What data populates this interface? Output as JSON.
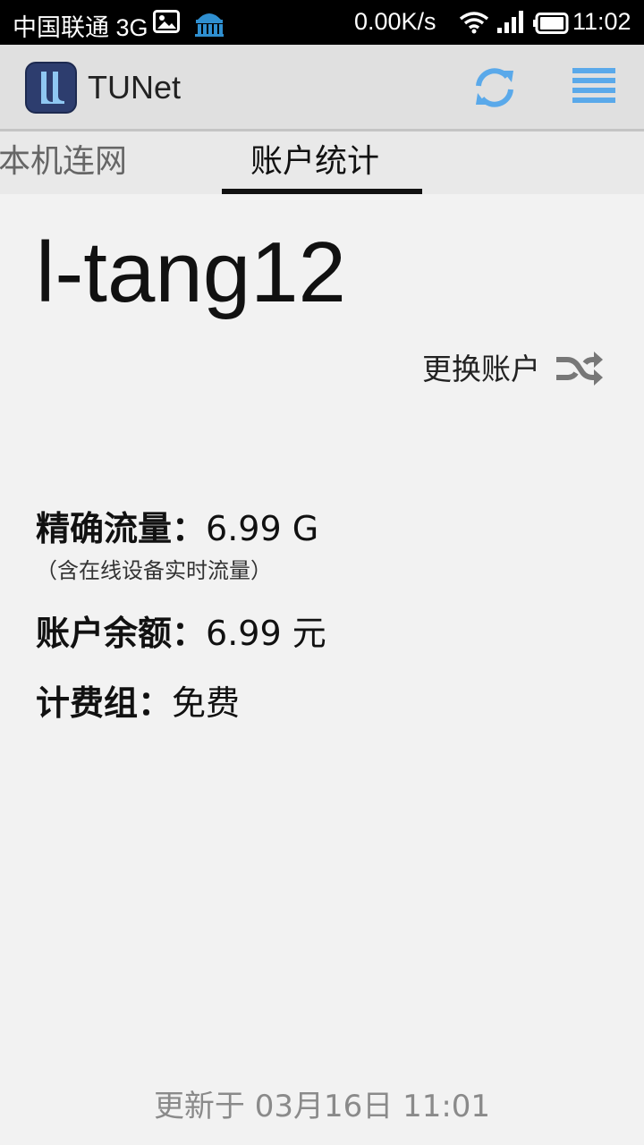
{
  "status_bar": {
    "carrier": "中国联通 3G",
    "net_speed": "0.00K/s",
    "time": "11:02",
    "icons": [
      "photo-icon",
      "university-app-icon",
      "wifi-icon",
      "signal-icon",
      "battery-icon"
    ]
  },
  "app_bar": {
    "title": "TUNet",
    "actions": [
      "refresh-icon",
      "menu-icon"
    ],
    "accent_color": "#5aa9ea"
  },
  "tabs": [
    {
      "label": "本机连网",
      "selected": false
    },
    {
      "label": "账户统计",
      "selected": true
    }
  ],
  "account": {
    "username": "l-tang12",
    "switch_label": "更换账户"
  },
  "stats": {
    "colon": "：",
    "traffic_label": "精确流量",
    "traffic_value": "6.99 G",
    "traffic_note": "（含在线设备实时流量）",
    "balance_label": "账户余额",
    "balance_value": "6.99 元",
    "group_label": "计费组",
    "group_value": "免费"
  },
  "footer": {
    "updated": "更新于 03月16日 11:01"
  }
}
